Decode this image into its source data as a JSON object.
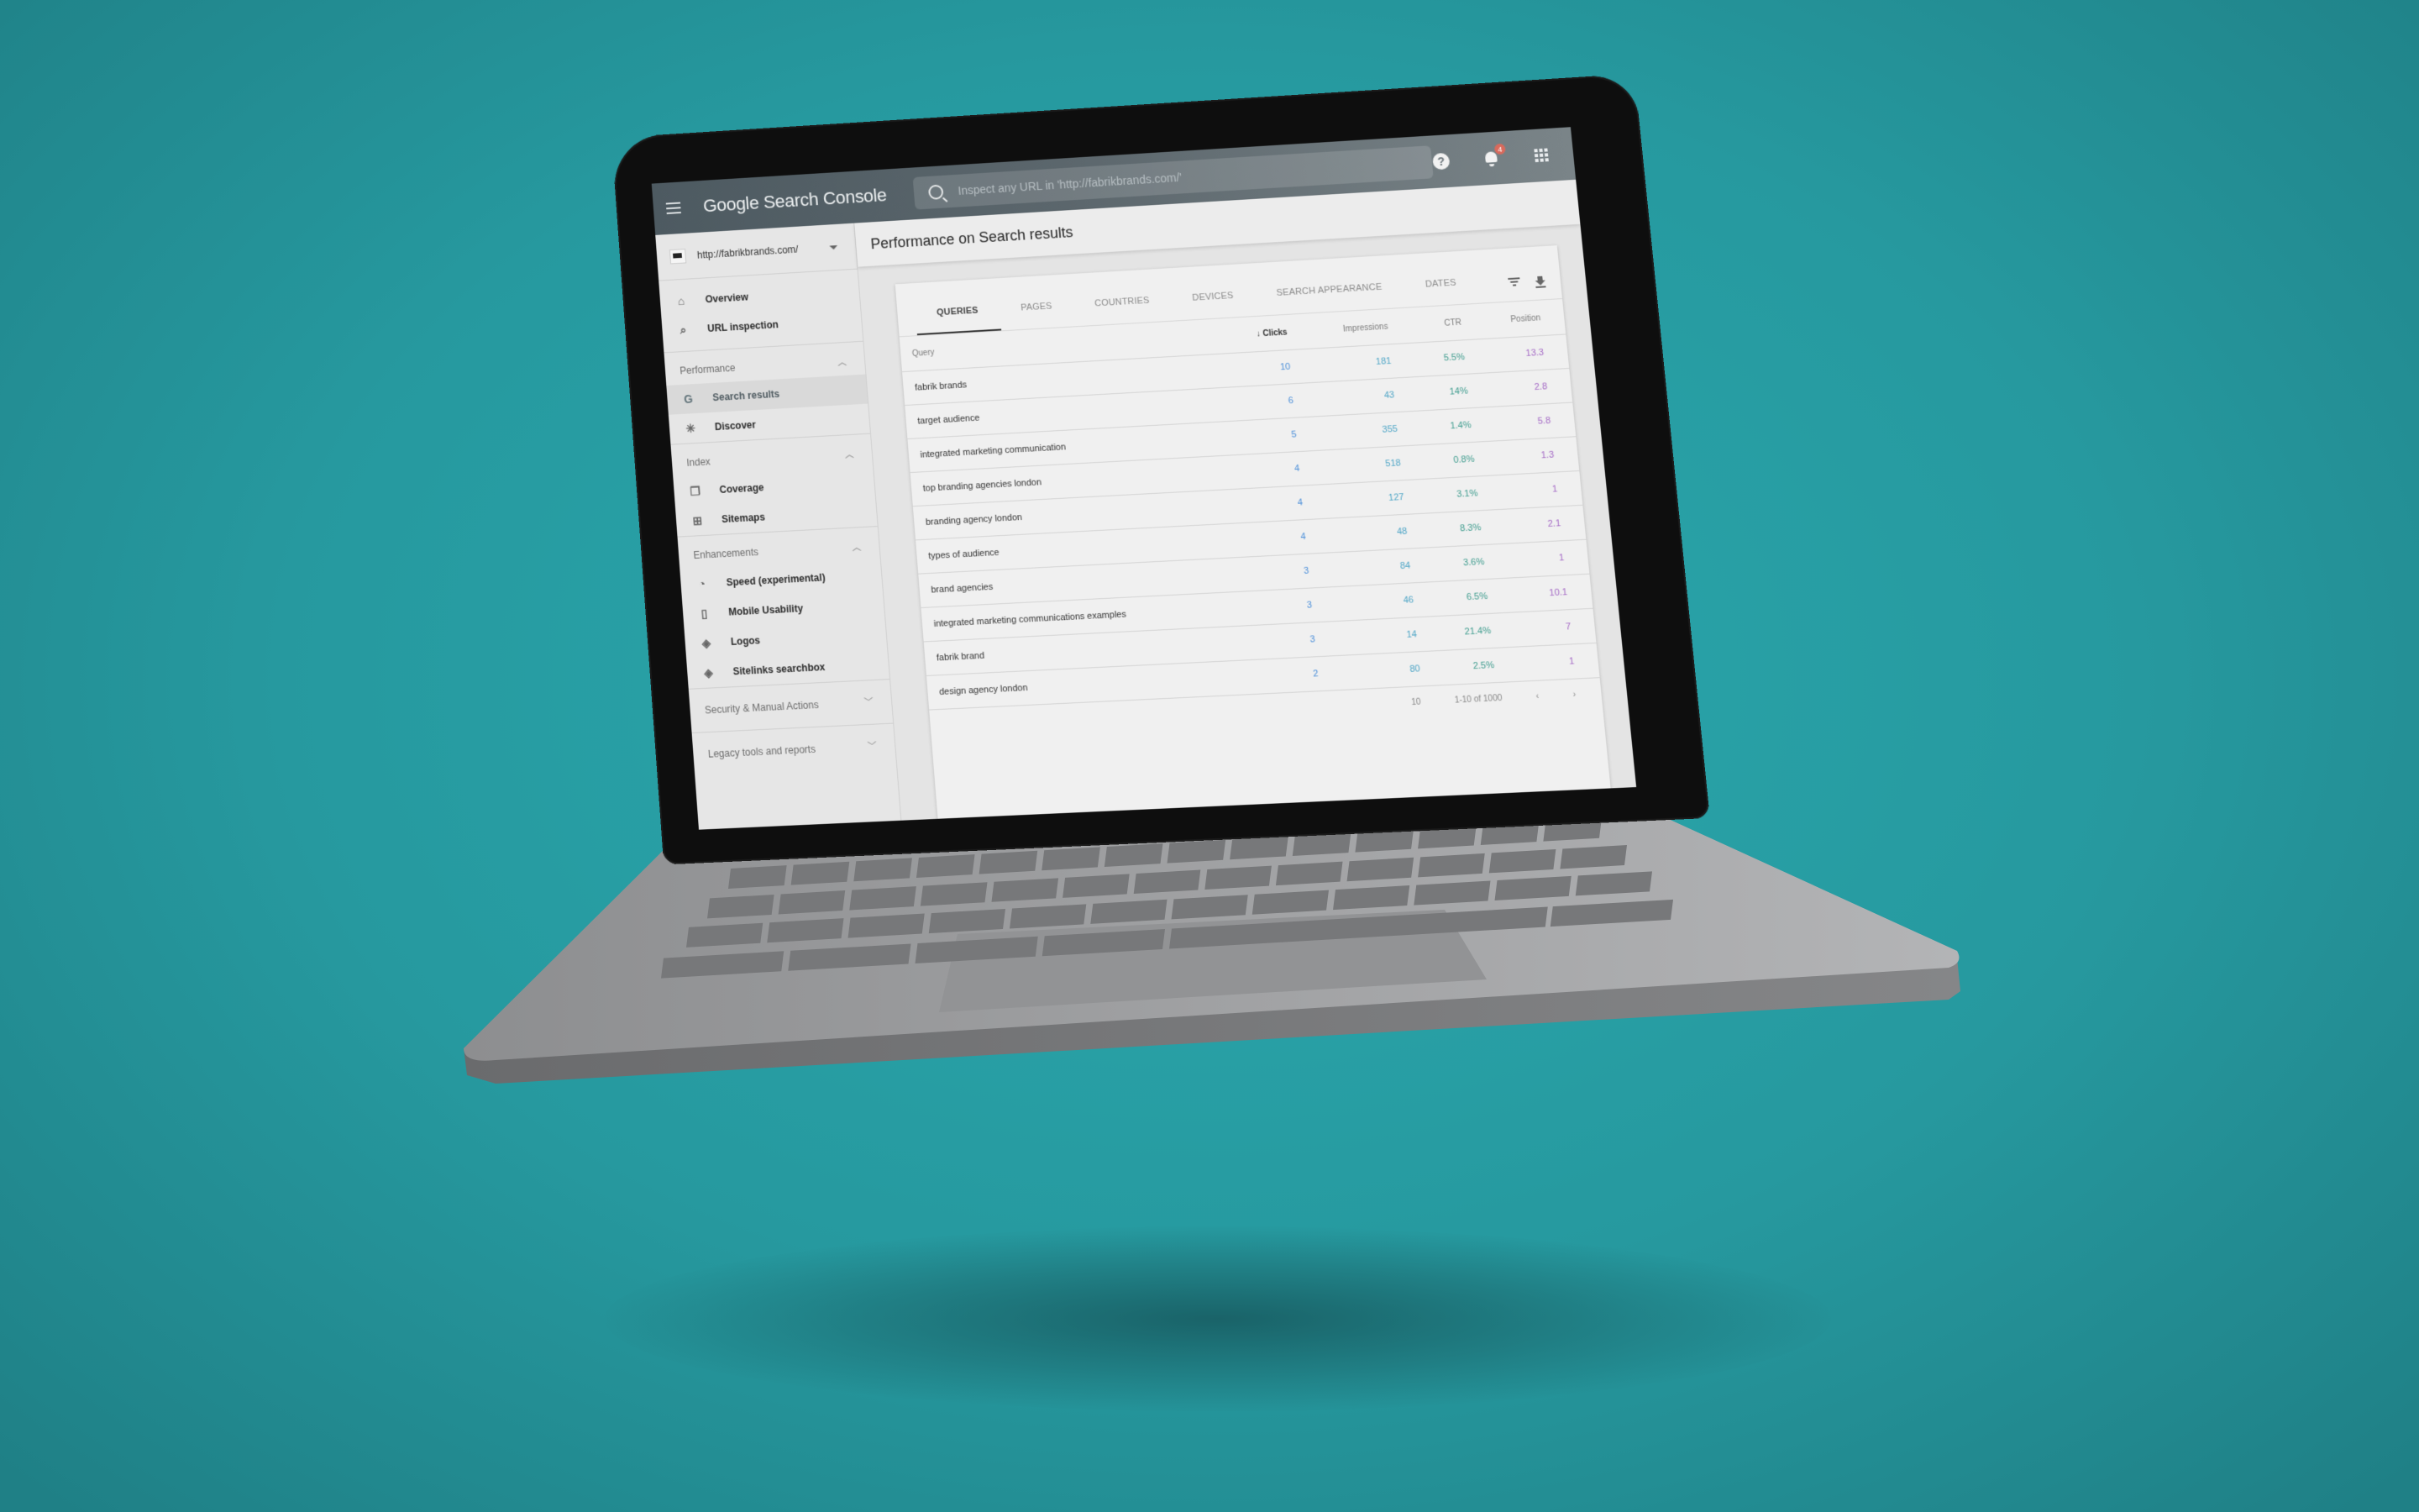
{
  "app": {
    "brand": "Google Search Console",
    "search_placeholder": "Inspect any URL in 'http://fabrikbrands.com/'",
    "notification_count": "4",
    "icons": {
      "menu": "hamburger-icon",
      "search": "search-icon",
      "help": "help-icon",
      "notifications": "bell-icon",
      "apps": "apps-grid-icon"
    }
  },
  "sidebar": {
    "property": "http://fabrikbrands.com/",
    "top_items": [
      {
        "label": "Overview",
        "icon": "home-icon"
      },
      {
        "label": "URL inspection",
        "icon": "search-icon"
      }
    ],
    "sections": [
      {
        "title": "Performance",
        "expanded": true,
        "items": [
          {
            "label": "Search results",
            "icon": "google-g-icon",
            "active": true
          },
          {
            "label": "Discover",
            "icon": "asterisk-icon"
          }
        ]
      },
      {
        "title": "Index",
        "expanded": true,
        "items": [
          {
            "label": "Coverage",
            "icon": "pages-icon"
          },
          {
            "label": "Sitemaps",
            "icon": "sitemap-icon"
          }
        ]
      },
      {
        "title": "Enhancements",
        "expanded": true,
        "items": [
          {
            "label": "Speed (experimental)",
            "icon": "gauge-icon"
          },
          {
            "label": "Mobile Usability",
            "icon": "phone-icon"
          },
          {
            "label": "Logos",
            "icon": "layers-icon"
          },
          {
            "label": "Sitelinks searchbox",
            "icon": "layers-icon"
          }
        ]
      }
    ],
    "collapsed_sections": [
      "Security & Manual Actions",
      "Legacy tools and reports"
    ]
  },
  "main": {
    "title": "Performance on Search results",
    "tabs": [
      "QUERIES",
      "PAGES",
      "COUNTRIES",
      "DEVICES",
      "SEARCH APPEARANCE",
      "DATES"
    ],
    "active_tab": "QUERIES",
    "columns": [
      "Query",
      "Clicks",
      "Impressions",
      "CTR",
      "Position"
    ],
    "sorted_column": "Clicks",
    "rows": [
      {
        "query": "fabrik brands",
        "clicks": "10",
        "impressions": "181",
        "ctr": "5.5%",
        "position": "13.3"
      },
      {
        "query": "target audience",
        "clicks": "6",
        "impressions": "43",
        "ctr": "14%",
        "position": "2.8"
      },
      {
        "query": "integrated marketing communication",
        "clicks": "5",
        "impressions": "355",
        "ctr": "1.4%",
        "position": "5.8"
      },
      {
        "query": "top branding agencies london",
        "clicks": "4",
        "impressions": "518",
        "ctr": "0.8%",
        "position": "1.3"
      },
      {
        "query": "branding agency london",
        "clicks": "4",
        "impressions": "127",
        "ctr": "3.1%",
        "position": "1"
      },
      {
        "query": "types of audience",
        "clicks": "4",
        "impressions": "48",
        "ctr": "8.3%",
        "position": "2.1"
      },
      {
        "query": "brand agencies",
        "clicks": "3",
        "impressions": "84",
        "ctr": "3.6%",
        "position": "1"
      },
      {
        "query": "integrated marketing communications examples",
        "clicks": "3",
        "impressions": "46",
        "ctr": "6.5%",
        "position": "10.1"
      },
      {
        "query": "fabrik brand",
        "clicks": "3",
        "impressions": "14",
        "ctr": "21.4%",
        "position": "7"
      },
      {
        "query": "design agency london",
        "clicks": "2",
        "impressions": "80",
        "ctr": "2.5%",
        "position": "1"
      }
    ],
    "footer": {
      "rows_per_page": "10",
      "range": "1-10 of 1000",
      "prev": "‹",
      "next": "›"
    }
  },
  "colors": {
    "background": "#27a0a6",
    "appbar": "#56626a",
    "clicks": "#4a8ed9",
    "impressions": "#4ea5c6",
    "ctr": "#3f9c8e",
    "position": "#a469c5",
    "badge": "#d96a5c"
  }
}
